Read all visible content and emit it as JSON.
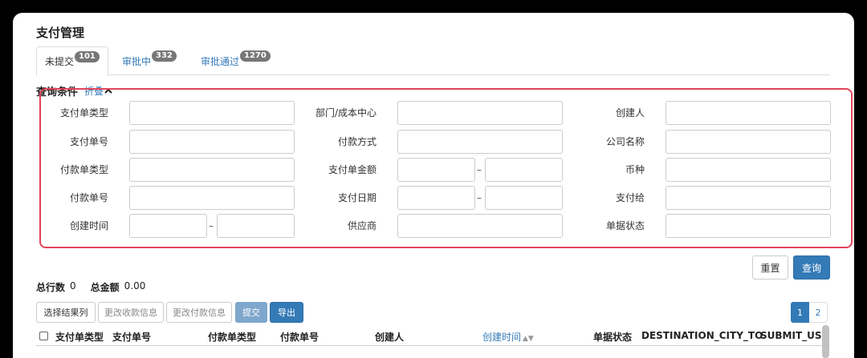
{
  "page_title": "支付管理",
  "tabs": [
    {
      "label": "未提交",
      "count": "101",
      "active": true
    },
    {
      "label": "审批中",
      "count": "332",
      "active": false
    },
    {
      "label": "审批通过",
      "count": "1270",
      "active": false
    }
  ],
  "query": {
    "title": "查询条件",
    "collapse_label": "折叠",
    "collapse_icon": "chevron-up-icon",
    "range_separator": "–",
    "fields": {
      "pay_doc_type": "支付单类型",
      "dept_cost_center": "部门/成本中心",
      "creator": "创建人",
      "pay_doc_no": "支付单号",
      "payment_method": "付款方式",
      "company_name": "公司名称",
      "payment_doc_type": "付款单类型",
      "pay_doc_amount": "支付单金额",
      "currency": "币种",
      "payment_doc_no": "付款单号",
      "pay_date": "支付日期",
      "pay_to": "支付给",
      "create_time": "创建时间",
      "supplier": "供应商",
      "doc_status": "单据状态"
    }
  },
  "actions": {
    "reset": "重置",
    "search": "查询"
  },
  "summary": {
    "total_rows_label": "总行数",
    "total_rows": "0",
    "total_amount_label": "总金额",
    "total_amount": "0.00"
  },
  "toolbar": {
    "select_columns": "选择结果列",
    "change_receipt_info": "更改收款信息",
    "change_payment_info": "更改付款信息",
    "submit": "提交",
    "export": "导出"
  },
  "pagination": {
    "pages": [
      "1",
      "2"
    ],
    "current": "1"
  },
  "table": {
    "columns": [
      "支付单类型",
      "支付单号",
      "付款单类型",
      "付款单号",
      "创建人",
      "创建时间",
      "单据状态",
      "DESTINATION_CITY_TO",
      "SUBMIT_USE"
    ],
    "sorted_column": "创建时间"
  },
  "colors": {
    "accent": "#337ab7",
    "highlight": "#e0445a",
    "badge": "#777777"
  }
}
